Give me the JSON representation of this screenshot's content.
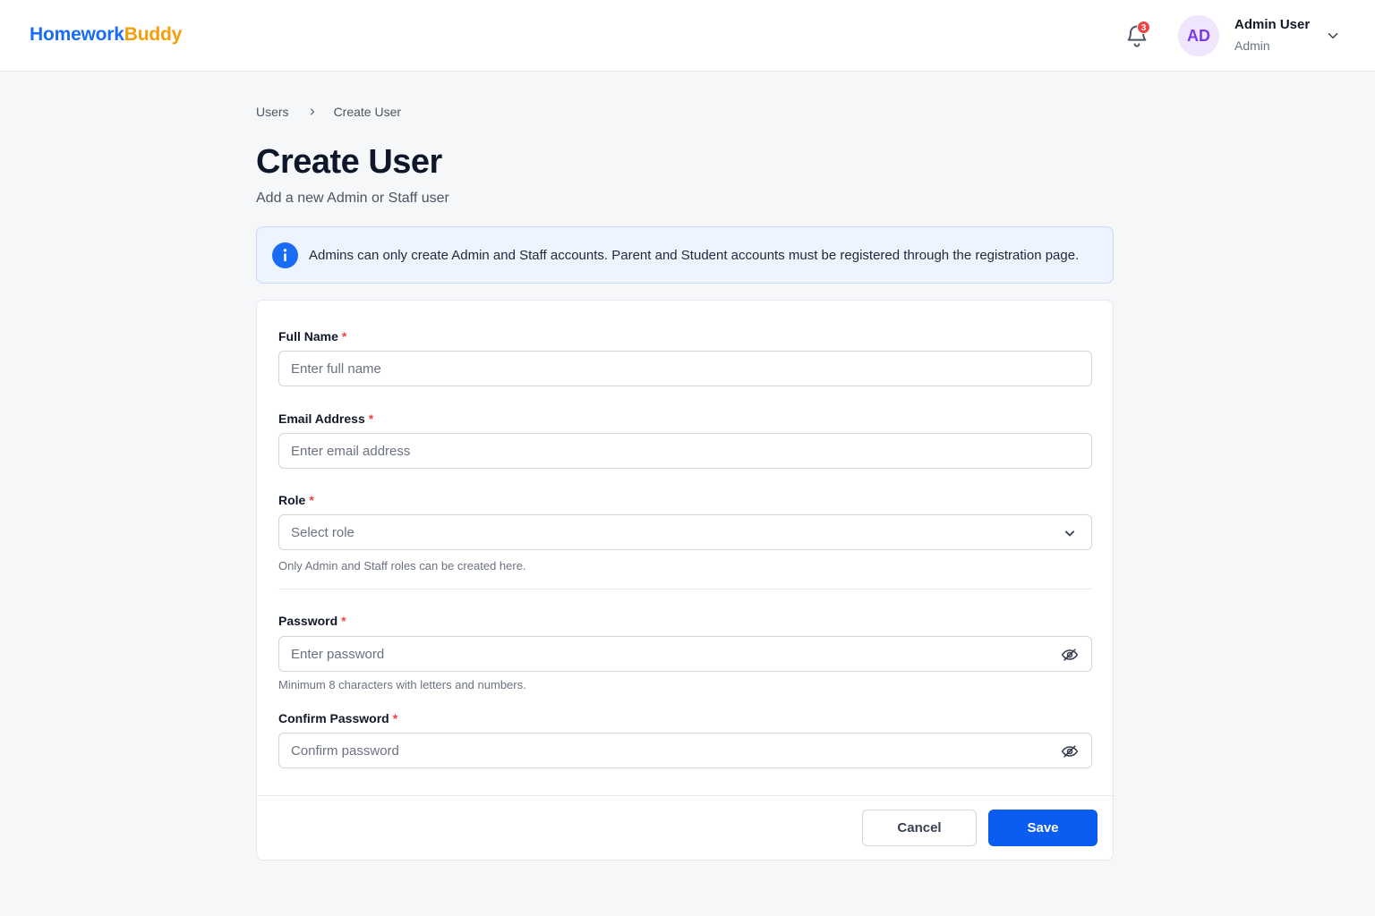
{
  "brand": {
    "name_part1": "Homework",
    "name_part2": "Buddy",
    "color_primary": "#1a6cf5",
    "color_accent": "#f59e0b"
  },
  "header": {
    "notifications": {
      "icon": "bell-icon",
      "count": "3"
    },
    "user": {
      "initials": "AD",
      "name": "Admin User",
      "role": "Admin",
      "menu_icon": "chevron-down-icon"
    }
  },
  "breadcrumb": {
    "items": [
      "Users",
      "Create User"
    ],
    "separator_icon": "chevron-right-icon"
  },
  "page": {
    "title": "Create User",
    "subtitle": "Add a new Admin or Staff user"
  },
  "info": {
    "icon": "info-icon",
    "text": "Admins can only create Admin and Staff accounts. Parent and Student accounts must be registered through the registration page."
  },
  "form": {
    "required_marker": "*",
    "full_name": {
      "label": "Full Name",
      "placeholder": "Enter full name",
      "value": ""
    },
    "email": {
      "label": "Email Address",
      "placeholder": "Enter email address",
      "value": ""
    },
    "role": {
      "label": "Role",
      "placeholder": "Select role",
      "value": "",
      "hint": "Only Admin and Staff roles can be created here.",
      "icon": "chevron-down-icon"
    },
    "password": {
      "label": "Password",
      "placeholder": "Enter password",
      "value": "",
      "hint": "Minimum 8 characters with letters and numbers.",
      "icon": "eye-off-icon"
    },
    "confirm_password": {
      "label": "Confirm Password",
      "placeholder": "Confirm password",
      "value": "",
      "icon": "eye-off-icon"
    }
  },
  "actions": {
    "cancel": "Cancel",
    "save": "Save"
  },
  "colors": {
    "primary_button": "#0b5cf0",
    "required": "#ef4444",
    "avatar_bg": "#efe5fc",
    "avatar_fg": "#7c3aed",
    "badge": "#ef4444"
  }
}
